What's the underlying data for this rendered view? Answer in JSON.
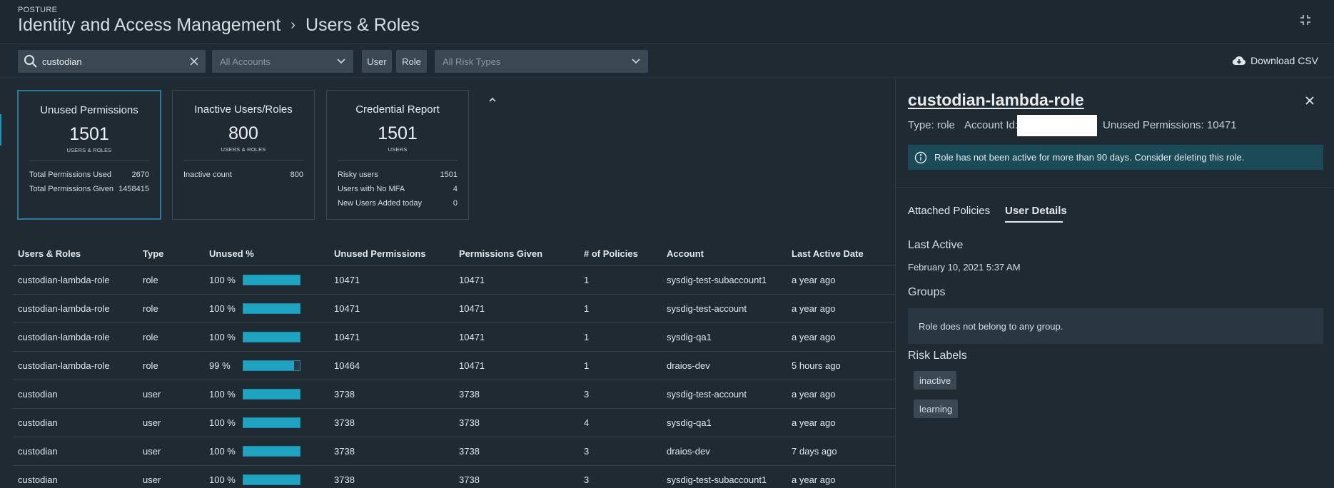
{
  "header": {
    "section": "POSTURE",
    "crumb_parent": "Identity and Access Management",
    "crumb_sep": "›",
    "crumb_current": "Users & Roles"
  },
  "toolbar": {
    "search_value": "custodian",
    "accounts_placeholder": "All Accounts",
    "user_filter": "User",
    "role_filter": "Role",
    "risk_placeholder": "All Risk Types",
    "download_label": "Download CSV"
  },
  "cards": [
    {
      "title": "Unused Permissions",
      "value": "1501",
      "sub": "USERS & ROLES",
      "stats": [
        {
          "label": "Total Permissions Used",
          "value": "2670"
        },
        {
          "label": "Total Permissions Given",
          "value": "1458415"
        }
      ]
    },
    {
      "title": "Inactive Users/Roles",
      "value": "800",
      "sub": "USERS & ROLES",
      "stats": [
        {
          "label": "Inactive count",
          "value": "800"
        }
      ]
    },
    {
      "title": "Credential Report",
      "value": "1501",
      "sub": "USERS",
      "stats": [
        {
          "label": "Risky users",
          "value": "1501"
        },
        {
          "label": "Users with No MFA",
          "value": "4"
        },
        {
          "label": "New Users Added today",
          "value": "0"
        }
      ]
    }
  ],
  "table": {
    "columns": [
      "Users & Roles",
      "Type",
      "Unused %",
      "Unused Permissions",
      "Permissions Given",
      "# of Policies",
      "Account",
      "Last Active Date"
    ],
    "rows": [
      {
        "name": "custodian-lambda-role",
        "type": "role",
        "pct_label": "100 %",
        "pct": 100,
        "unused": "10471",
        "given": "10471",
        "policies": "1",
        "account": "sysdig-test-subaccount1",
        "last": "a year ago"
      },
      {
        "name": "custodian-lambda-role",
        "type": "role",
        "pct_label": "100 %",
        "pct": 100,
        "unused": "10471",
        "given": "10471",
        "policies": "1",
        "account": "sysdig-test-account",
        "last": "a year ago"
      },
      {
        "name": "custodian-lambda-role",
        "type": "role",
        "pct_label": "100 %",
        "pct": 100,
        "unused": "10471",
        "given": "10471",
        "policies": "1",
        "account": "sysdig-qa1",
        "last": "a year ago"
      },
      {
        "name": "custodian-lambda-role",
        "type": "role",
        "pct_label": "99 %",
        "pct": 99,
        "unused": "10464",
        "given": "10471",
        "policies": "1",
        "account": "draios-dev",
        "last": "5 hours ago"
      },
      {
        "name": "custodian",
        "type": "user",
        "pct_label": "100 %",
        "pct": 100,
        "unused": "3738",
        "given": "3738",
        "policies": "3",
        "account": "sysdig-test-account",
        "last": "a year ago"
      },
      {
        "name": "custodian",
        "type": "user",
        "pct_label": "100 %",
        "pct": 100,
        "unused": "3738",
        "given": "3738",
        "policies": "4",
        "account": "sysdig-qa1",
        "last": "a year ago"
      },
      {
        "name": "custodian",
        "type": "user",
        "pct_label": "100 %",
        "pct": 100,
        "unused": "3738",
        "given": "3738",
        "policies": "3",
        "account": "draios-dev",
        "last": "7 days ago"
      },
      {
        "name": "custodian",
        "type": "user",
        "pct_label": "100 %",
        "pct": 100,
        "unused": "3738",
        "given": "3738",
        "policies": "3",
        "account": "sysdig-test-subaccount1",
        "last": "a year ago"
      }
    ]
  },
  "panel": {
    "title": "custodian-lambda-role",
    "type_text": "Type: role",
    "account_label": "Account Id:",
    "unused_text": "Unused Permissions: 10471",
    "alert": "Role has not been active for more than 90 days. Consider deleting this role.",
    "tabs": [
      "Attached Policies",
      "User Details"
    ],
    "last_active_heading": "Last Active",
    "last_active_value": "February 10, 2021 5:37 AM",
    "groups_heading": "Groups",
    "groups_value": "Role does not belong to any group.",
    "risk_heading": "Risk Labels",
    "risk_labels": [
      "inactive",
      "learning"
    ]
  },
  "colors": {
    "accent": "#1fa3c1",
    "background": "#1f2a33",
    "alert_bg": "#1b4a59"
  }
}
